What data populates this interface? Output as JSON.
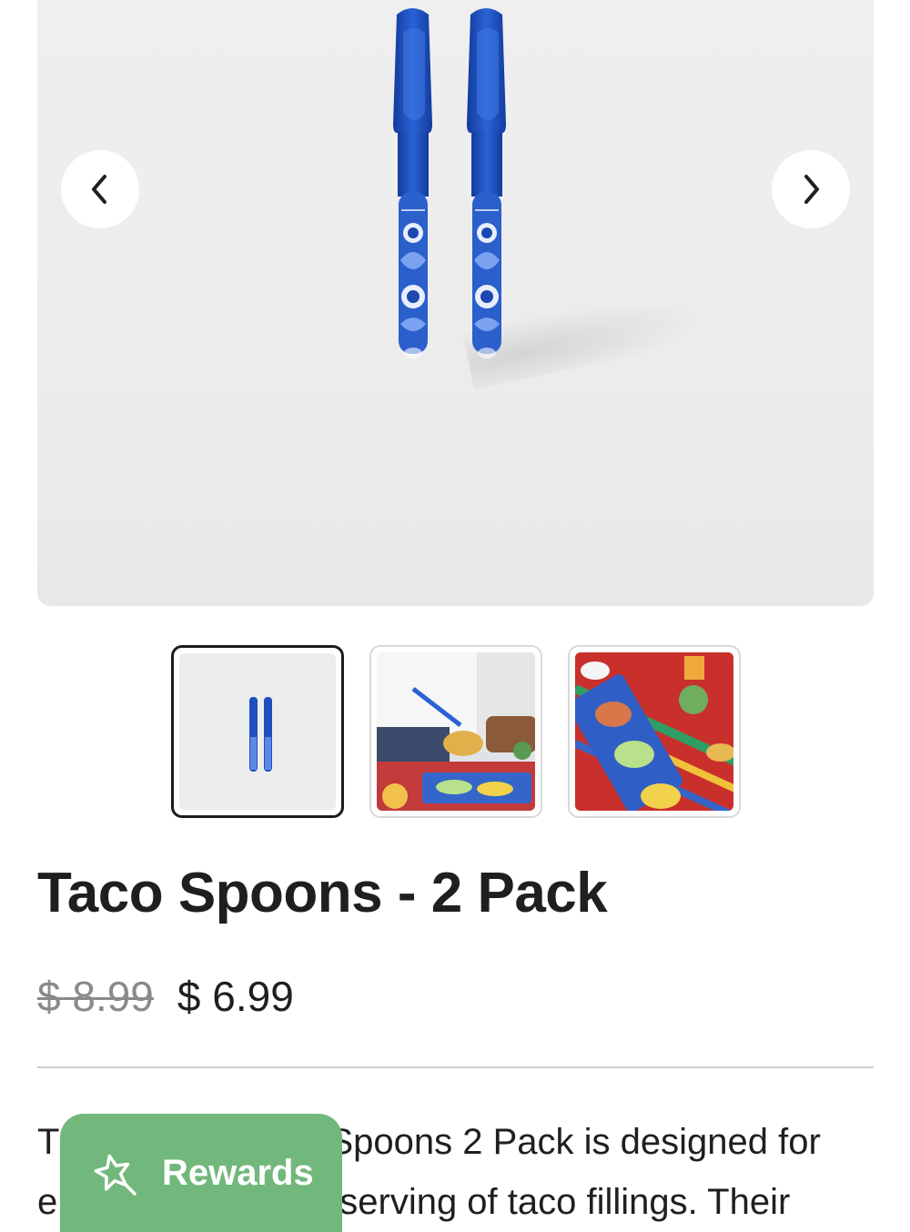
{
  "gallery": {
    "prev_icon": "chevron-left-icon",
    "next_icon": "chevron-right-icon",
    "thumbnails": [
      {
        "name": "thumbnail-spoons",
        "selected": true
      },
      {
        "name": "thumbnail-serving-tacos",
        "selected": false
      },
      {
        "name": "thumbnail-taco-bar",
        "selected": false
      }
    ]
  },
  "product": {
    "title": "Taco Spoons - 2 Pack",
    "original_price": "$ 8.99",
    "sale_price": "$ 6.99",
    "description_line1_visible": "Spoons 2 Pack is designed for",
    "description_line1_start": "T",
    "description_line2_visible": "serving of taco fillings. Their",
    "description_line2_start": "e"
  },
  "rewards": {
    "label": "Rewards",
    "icon": "star-icon",
    "color": "#72b77c"
  },
  "colors": {
    "spoon_blue": "#1f4fbf",
    "divider": "#cfcfcf"
  }
}
